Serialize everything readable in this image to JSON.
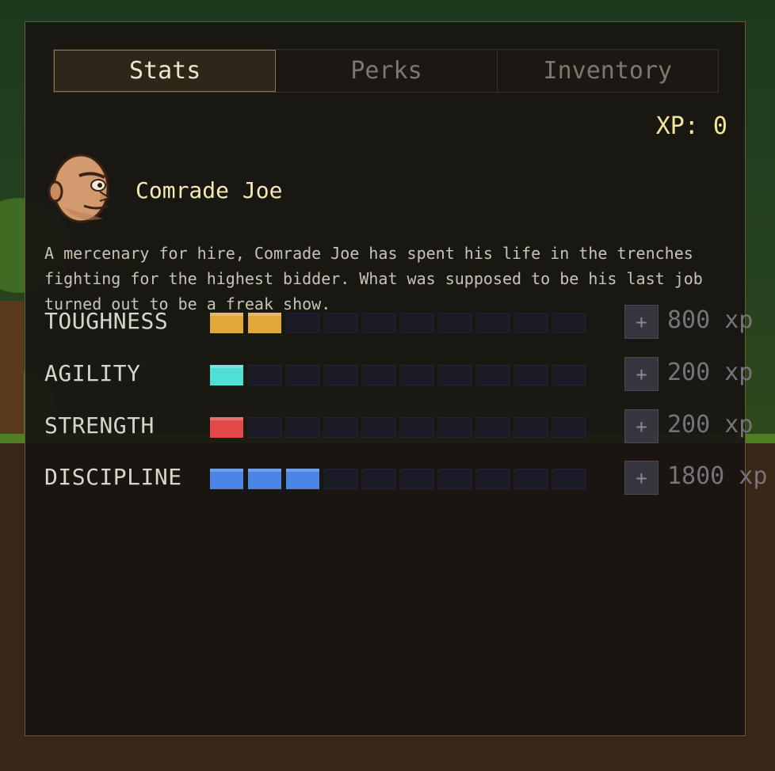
{
  "tabs": [
    {
      "label": "Stats",
      "active": true
    },
    {
      "label": "Perks",
      "active": false
    },
    {
      "label": "Inventory",
      "active": false
    }
  ],
  "xp_label": "XP: 0",
  "character": {
    "name": "Comrade Joe",
    "description": "A mercenary for hire, Comrade Joe has spent his life in the trenches fighting for the highest bidder. What was supposed to be his last job turned out to be a freak show."
  },
  "stats": [
    {
      "label": "TOUGHNESS",
      "level": 2,
      "max": 10,
      "color": "#e0a838",
      "cost": "800 xp"
    },
    {
      "label": "AGILITY",
      "level": 1,
      "max": 10,
      "color": "#4edfd6",
      "cost": "200 xp"
    },
    {
      "label": "STRENGTH",
      "level": 1,
      "max": 10,
      "color": "#e24a4a",
      "cost": "200 xp"
    },
    {
      "label": "DISCIPLINE",
      "level": 3,
      "max": 10,
      "color": "#4a84e4",
      "cost": "1800 xp"
    }
  ],
  "icons": {
    "plus": "+"
  }
}
